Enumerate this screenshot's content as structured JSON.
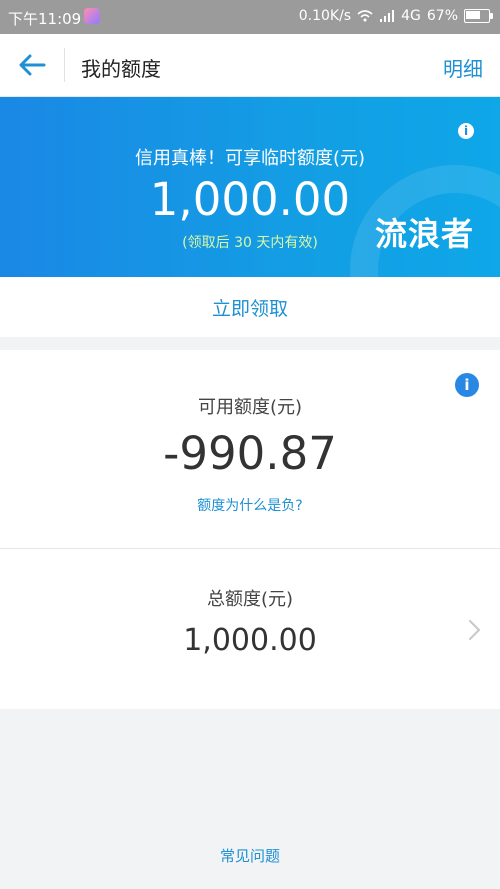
{
  "status_bar": {
    "time": "下午11:09",
    "network_speed": "0.10K/s",
    "network_type": "4G",
    "battery": "67%"
  },
  "header": {
    "back_icon": "arrow-left-icon",
    "title": "我的额度",
    "detail_link": "明细"
  },
  "banner": {
    "message": "信用真棒！可享临时额度(元)",
    "amount": "1,000.00",
    "note": "(领取后 30 天内有效)",
    "info_label": "i",
    "watermark": "流浪者"
  },
  "claim": {
    "label": "立即领取"
  },
  "available": {
    "label": "可用额度(元)",
    "value": "-990.87",
    "info_label": "i",
    "negative_question": "额度为什么是负?"
  },
  "total": {
    "label": "总额度(元)",
    "value": "1,000.00",
    "chevron_icon": "chevron-right-icon"
  },
  "faq": {
    "label": "常见问题"
  },
  "colors": {
    "primary": "#1e90d3",
    "banner_start": "#1a88e5",
    "banner_end": "#0ea7e8",
    "note_green": "#d8f7a9",
    "page_background": "#f2f3f5"
  }
}
